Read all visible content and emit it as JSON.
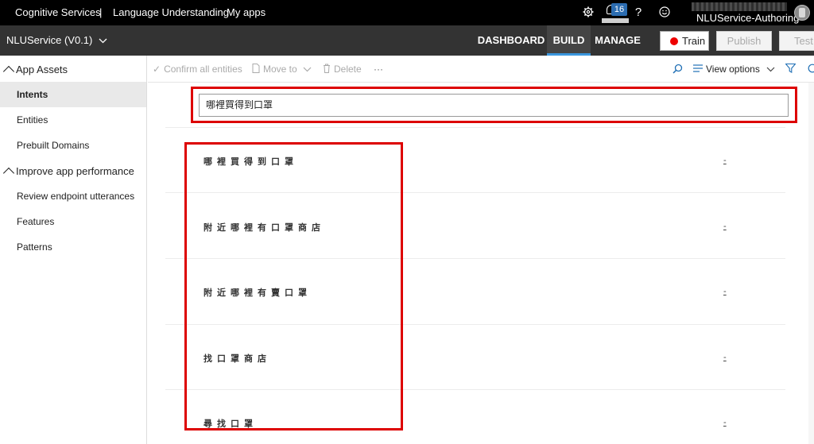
{
  "topbar": {
    "breadcrumb_1": "Cognitive Services",
    "separator": "|",
    "breadcrumb_2": "Language Understanding",
    "breadcrumb_3": "My apps",
    "notification_count": "16",
    "help_glyph": "?",
    "username": "NLUService-Authoring",
    "icons": [
      "gear-icon",
      "bell-icon",
      "help-icon",
      "smiley-icon",
      "avatar"
    ]
  },
  "navbar": {
    "app_name": "NLUService (V0.1)",
    "tabs": [
      {
        "label": "DASHBOARD",
        "active": false
      },
      {
        "label": "BUILD",
        "active": true
      },
      {
        "label": "MANAGE",
        "active": false
      }
    ],
    "train_label": "Train",
    "publish_label": "Publish",
    "test_label": "Test",
    "accent_color": "#3a96dd",
    "train_dot_color": "#e00000"
  },
  "sidebar": {
    "groups": [
      {
        "label": "App Assets",
        "items": [
          "Intents",
          "Entities",
          "Prebuilt Domains"
        ]
      },
      {
        "label": "Improve app performance",
        "items": [
          "Review endpoint utterances",
          "Features",
          "Patterns"
        ]
      }
    ],
    "selected": "Intents"
  },
  "toolbar": {
    "confirm_label": "Confirm all entities",
    "move_label": "Move to",
    "delete_label": "Delete",
    "more_label": "···",
    "view_options_label": "View options"
  },
  "search": {
    "value": "哪裡買得到口罩"
  },
  "utterances": [
    {
      "text": "哪裡買得到口罩",
      "intent": "-"
    },
    {
      "text": "附近哪裡有口罩商店",
      "intent": "-"
    },
    {
      "text": "附近哪裡有賣口罩",
      "intent": "-"
    },
    {
      "text": "找口罩商店",
      "intent": "-"
    },
    {
      "text": "尋找口罩",
      "intent": "-"
    }
  ],
  "highlight_color": "#dd0000"
}
